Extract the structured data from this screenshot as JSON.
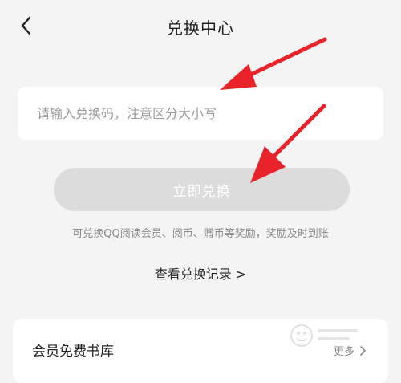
{
  "header": {
    "title": "兑换中心",
    "back_icon": "chevron-left-icon"
  },
  "redeem": {
    "placeholder": "请输入兑换码，注意区分大小写",
    "button_label": "立即兑换",
    "hint": "可兑换QQ阅读会员、阅币、赠币等奖励，奖励及时到账"
  },
  "history": {
    "label": "查看兑换记录 >"
  },
  "card": {
    "title": "会员免费书库",
    "more_label": "更多"
  },
  "annotations": {
    "arrow_color": "#e8232a"
  },
  "colors": {
    "background": "#f4f4f4",
    "button_disabled": "#dcdcdc"
  }
}
